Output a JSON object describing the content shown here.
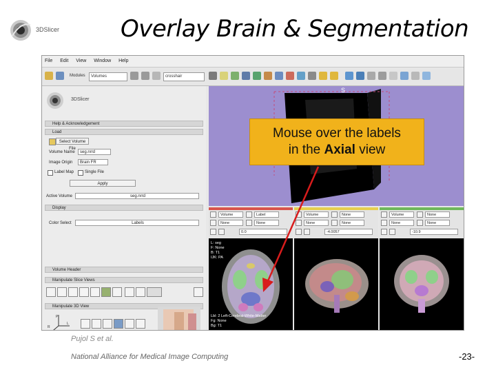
{
  "slide": {
    "title": "Overlay Brain & Segmentation",
    "logo_text": "3DSlicer",
    "author": "Pujol S et al.",
    "organization": "National Alliance for Medical Image Computing",
    "page_number": "-23-"
  },
  "callout": {
    "line1": "Mouse over the labels",
    "line2_prefix": "in the ",
    "line2_bold": "Axial",
    "line2_suffix": " view",
    "color": "#f1b21b"
  },
  "app": {
    "menu": [
      "File",
      "Edit",
      "View",
      "Window",
      "Help"
    ],
    "toolbar": {
      "module_label": "Modules",
      "module_value": "Volumes",
      "search_value": "crosshair",
      "icon_names": [
        "data-icon",
        "save-icon",
        "home-icon",
        "volumes-icon",
        "models-icon",
        "fiducials-icon",
        "editor-icon",
        "undo-icon",
        "redo-icon",
        "layout-icon",
        "transform-icon",
        "view-icon",
        "camera-icon",
        "tools-icon",
        "grid-icon",
        "fullscreen-icon",
        "arrows-icon"
      ]
    },
    "inner_logo_text": "3DSlicer",
    "panel": {
      "help_section": "Help & Acknowledgement",
      "load_section": "Load",
      "select_volume_btn": "Select Volume File",
      "volume_name_label": "Volume Name",
      "volume_name_value": "seg.nrrd",
      "image_origin_label": "Image Origin",
      "image_origin_value": "Brain FR",
      "label_map_label": "Label Map",
      "single_file_label": "Single File",
      "apply_btn": "Apply",
      "active_volume_label": "Active Volume",
      "active_volume_value": "seg.nrrd",
      "display_section": "Display",
      "color_select_label": "Color Select",
      "color_select_value": "Labels",
      "header_section": "Volume Header",
      "manip_slice_section": "Manipulate Slice Views",
      "manip_3d_section": "Manipulate 3D View",
      "chevrons": "»"
    },
    "view3d": {
      "axis_label": "S",
      "bg": "#9c8ecf"
    },
    "slices": [
      {
        "name": "red",
        "color": "#d8554c",
        "fg": "Volume",
        "bg": "Label",
        "lb": "None",
        "offset": "0.0",
        "info": "L: seg\nF: None\nB: T1\nIJK: PA",
        "bottom": "Lbl: 2 Left-Cerebral-White-Matter\nFg: None\nBg: T1"
      },
      {
        "name": "yellow",
        "color": "#e6cf4f",
        "fg": "Volume",
        "bg": "None",
        "lb": "None",
        "offset": "-4.0057",
        "info": "",
        "bottom": ""
      },
      {
        "name": "green",
        "color": "#6fb85b",
        "fg": "Volume",
        "bg": "None",
        "lb": "None",
        "offset": "-10.9",
        "info": "",
        "bottom": ""
      }
    ]
  }
}
